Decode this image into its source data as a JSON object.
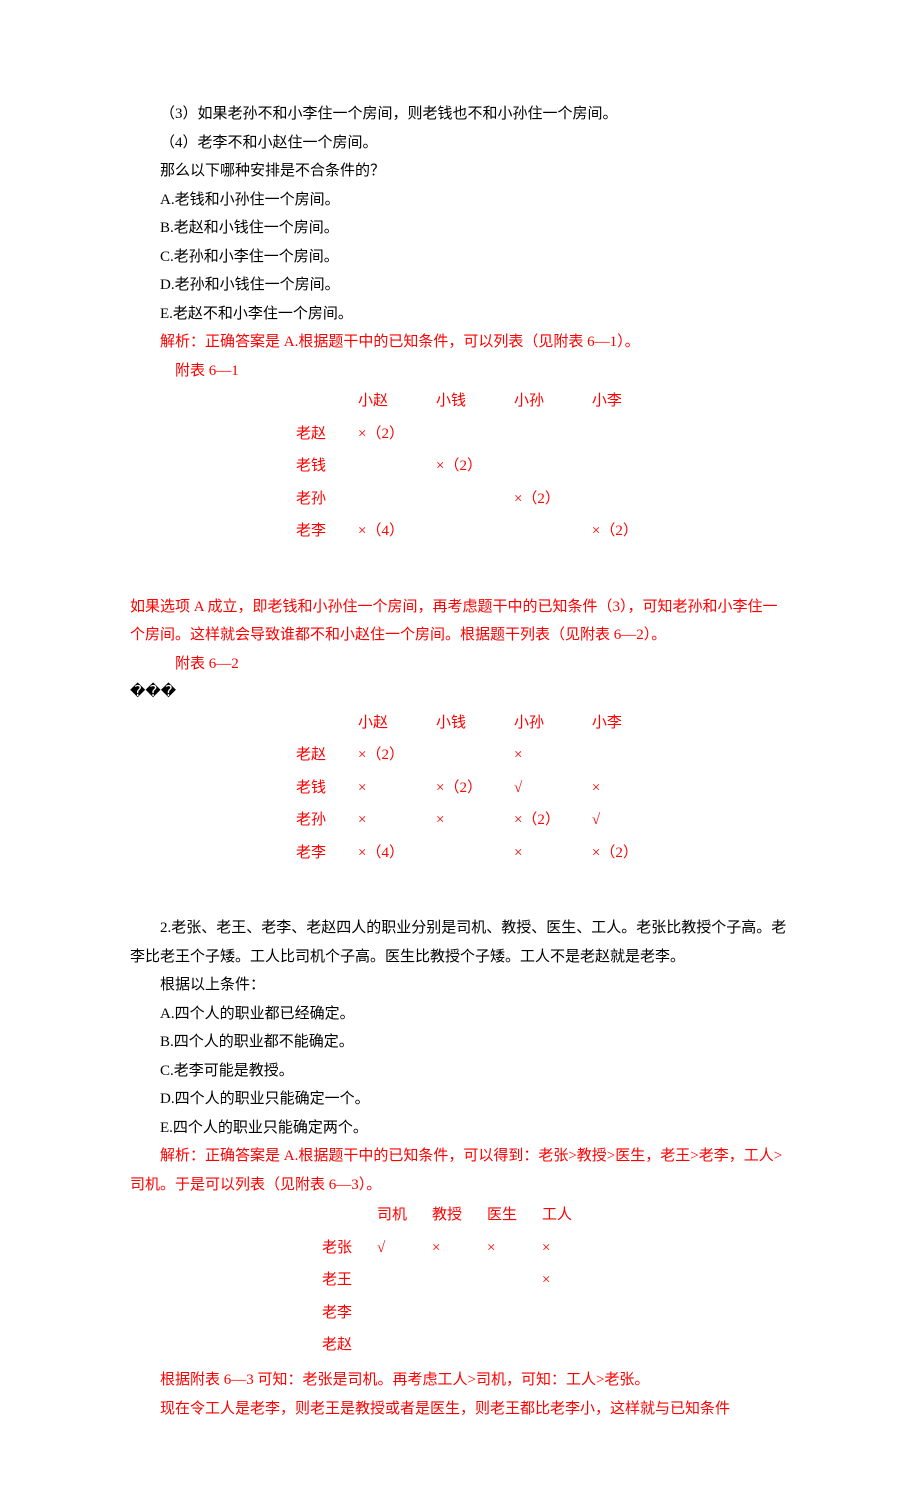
{
  "q1": {
    "premise3": "（3）如果老孙不和小李住一个房间，则老钱也不和小孙住一个房间。",
    "premise4": "（4）老李不和小赵住一个房间。",
    "question": "那么以下哪种安排是不合条件的？",
    "optA": "A.老钱和小孙住一个房间。",
    "optB": "B.老赵和小钱住一个房间。",
    "optC": "C.老孙和小李住一个房间。",
    "optD": "D.老孙和小钱住一个房间。",
    "optE": "E.老赵不和小李住一个房间。",
    "analysis_intro": "解析：正确答案是 A.根据题干中的已知条件，可以列表（见附表 6—1）。",
    "table1_caption": "附表 6—1",
    "table1": {
      "cols": [
        "小赵",
        "小钱",
        "小孙",
        "小李"
      ],
      "rows": [
        {
          "h": "老赵",
          "c": [
            "×（2）",
            "",
            "",
            ""
          ]
        },
        {
          "h": "老钱",
          "c": [
            "",
            "×（2）",
            "",
            ""
          ]
        },
        {
          "h": "老孙",
          "c": [
            "",
            "",
            "×（2）",
            ""
          ]
        },
        {
          "h": "老李",
          "c": [
            "×（4）",
            "",
            "",
            "×（2）"
          ]
        }
      ]
    },
    "analysis_mid": "如果选项 A 成立，即老钱和小孙住一个房间，再考虑题干中的已知条件（3），可知老孙和小李住一个房间。这样就会导致谁都不和小赵住一个房间。根据题干列表（见附表 6—2）。",
    "table2_caption": "附表 6—2",
    "table2": {
      "cols": [
        "小赵",
        "小钱",
        "小孙",
        "小李"
      ],
      "rows": [
        {
          "h": "老赵",
          "c": [
            "×（2）",
            "",
            "×",
            ""
          ]
        },
        {
          "h": "老钱",
          "c": [
            "×",
            "×（2）",
            "√",
            "×"
          ]
        },
        {
          "h": "老孙",
          "c": [
            "×",
            "×",
            "×（2）",
            "√"
          ]
        },
        {
          "h": "老李",
          "c": [
            "×（4）",
            "",
            "×",
            "×（2）"
          ]
        }
      ]
    }
  },
  "q2": {
    "stem": "2.老张、老王、老李、老赵四人的职业分别是司机、教授、医生、工人。老张比教授个子高。老李比老王个子矮。工人比司机个子高。医生比教授个子矮。工人不是老赵就是老李。",
    "condline": "根据以上条件：",
    "optA": "A.四个人的职业都已经确定。",
    "optB": "B.四个人的职业都不能确定。",
    "optC": "C.老李可能是教授。",
    "optD": "D.四个人的职业只能确定一个。",
    "optE": "E.四个人的职业只能确定两个。",
    "analysis_intro": "解析：正确答案是 A.根据题干中的已知条件，可以得到：老张>教授>医生，老王>老李，工人>司机。于是可以列表（见附表 6—3）。",
    "table3": {
      "cols": [
        "司机",
        "教授",
        "医生",
        "工人"
      ],
      "rows": [
        {
          "h": "老张",
          "c": [
            "√",
            "×",
            "×",
            "×"
          ]
        },
        {
          "h": "老王",
          "c": [
            "",
            "",
            "",
            "×"
          ]
        },
        {
          "h": "老李",
          "c": [
            "",
            "",
            "",
            ""
          ]
        },
        {
          "h": "老赵",
          "c": [
            "",
            "",
            "",
            ""
          ]
        }
      ]
    },
    "analysis_after1": "根据附表 6—3 可知：老张是司机。再考虑工人>司机，可知：工人>老张。",
    "analysis_after2": "现在令工人是老李，则老王是教授或者是医生，则老王都比老李小，这样就与已知条件"
  }
}
